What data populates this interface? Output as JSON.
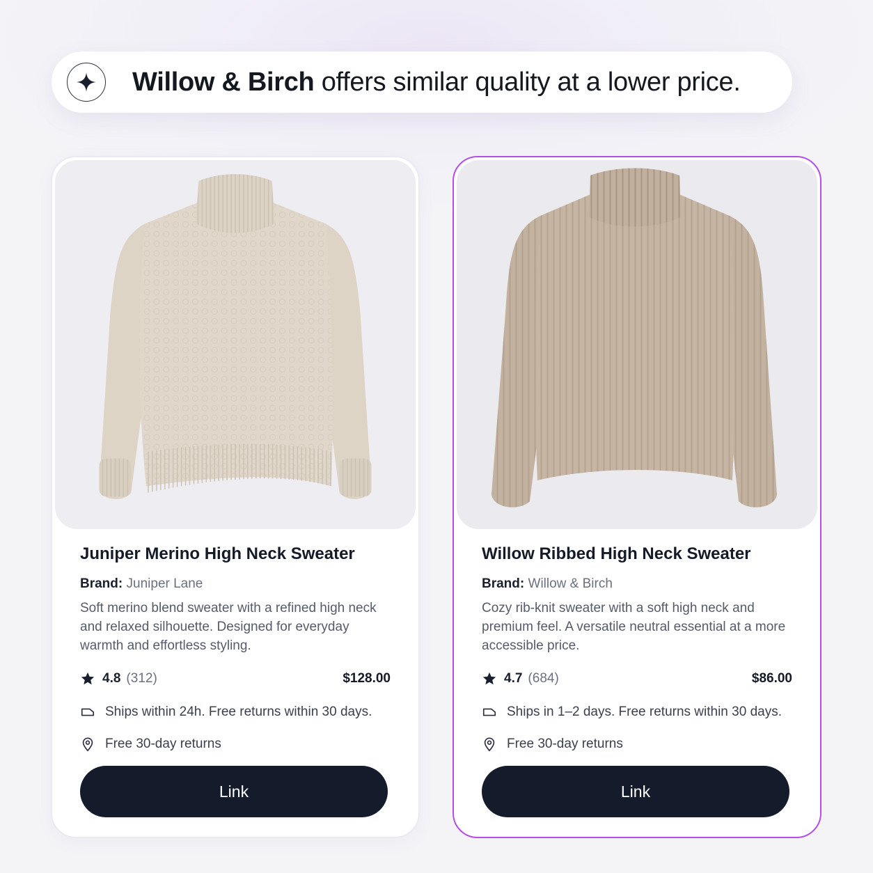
{
  "banner": {
    "icon": "sparkle-icon",
    "brand": "Willow & Birch",
    "message": " offers similar quality at a lower price."
  },
  "products": [
    {
      "image": "beige-merino-turtleneck-sweater",
      "title": "Juniper Merino High Neck Sweater",
      "brand_label": "Brand:",
      "brand": "Juniper Lane",
      "description": "Soft merino blend sweater with a refined high neck and relaxed silhouette. Designed for everyday warmth and effortless styling.",
      "rating": "4.8",
      "review_count": "(312)",
      "price": "$128.00",
      "shipping": "Ships within 24h. Free returns within 30 days.",
      "returns": "Free 30-day returns",
      "button_label": "Link",
      "highlighted": false
    },
    {
      "image": "taupe-ribbed-turtleneck-sweater",
      "title": "Willow Ribbed High Neck Sweater",
      "brand_label": "Brand:",
      "brand": "Willow & Birch",
      "description": "Cozy rib-knit sweater with a soft high neck and premium feel. A versatile neutral essential at a more accessible price.",
      "rating": "4.7",
      "review_count": "(684)",
      "price": "$86.00",
      "shipping": "Ships in 1–2 days. Free returns within 30 days.",
      "returns": "Free 30-day returns",
      "button_label": "Link",
      "highlighted": true
    }
  ],
  "colors": {
    "accent_border": "#b44ee6",
    "button_bg": "#141c2c",
    "sweater_left": "#ded5c8",
    "sweater_right": "#c5b4a2"
  }
}
